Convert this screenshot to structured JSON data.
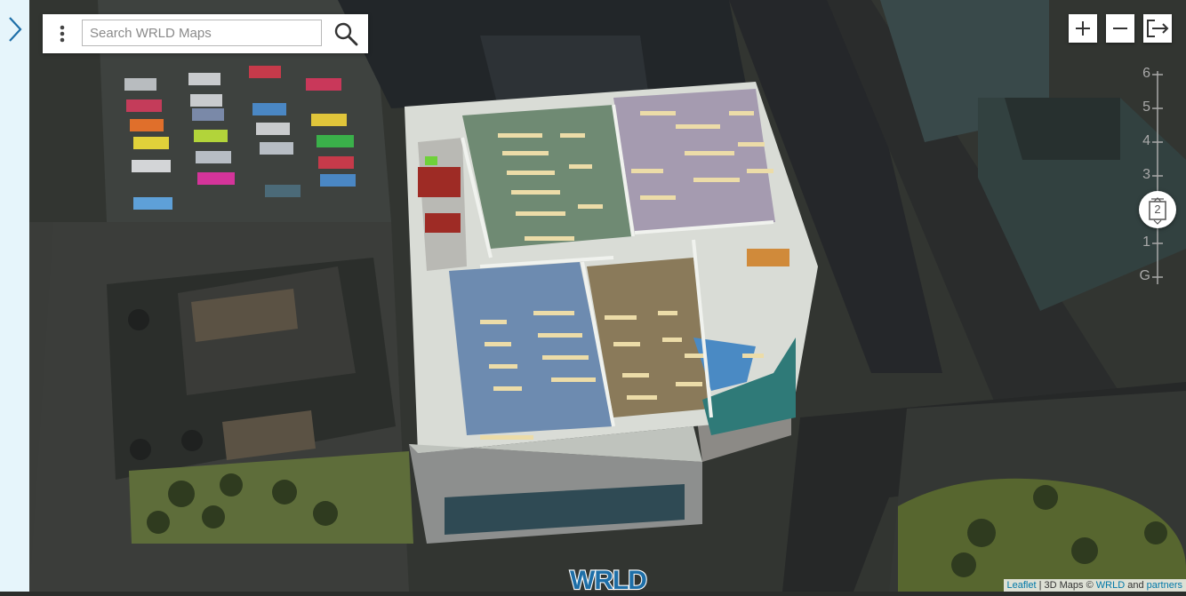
{
  "sidebar": {
    "expand_icon": "chevron-right-icon"
  },
  "search": {
    "placeholder": "Search WRLD Maps",
    "menu_icon": "vertical-dots-icon",
    "search_icon": "magnifier-icon"
  },
  "controls": {
    "zoom_in_icon": "plus-icon",
    "zoom_out_icon": "minus-icon",
    "exit_icon": "exit-icon"
  },
  "floors": {
    "labels": [
      "6",
      "5",
      "4",
      "3",
      "1",
      "G"
    ],
    "current": "2",
    "current_icon": "elevator-icon"
  },
  "logo": {
    "text": "WRLD"
  },
  "attribution": {
    "leaflet": "Leaflet",
    "separator": "|",
    "maps_text": "3D Maps ©",
    "wrld": "WRLD",
    "and": "and",
    "partners": "partners"
  },
  "colors": {
    "side_strip": "#e6f5fb",
    "accent": "#1e6fa8",
    "link": "#0078a8"
  }
}
